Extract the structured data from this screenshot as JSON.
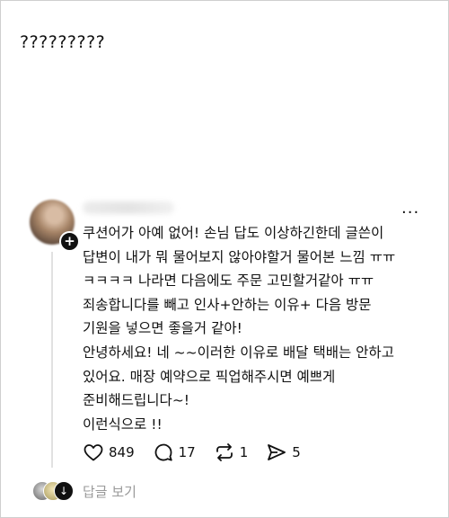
{
  "caption": "?????????",
  "post": {
    "lines": [
      "쿠션어가 아예 없어! 손님 답도 이상하긴한데 글쓴이",
      "답변이 내가 뭐 물어보지 않아야할거 물어본 느낌 ㅠㅠ",
      "ㅋㅋㅋㅋ 나라면 다음에도 주문 고민할거같아 ㅠㅠ",
      "죄송합니다를 빼고 인사+안하는 이유+ 다음 방문",
      "기원을 넣으면 좋을거 같아!",
      "안녕하세요! 네 ~~이러한 이유로 배달 택배는 안하고",
      "있어요. 매장 예약으로 픽업해주시면 예쁘게",
      "준비해드립니다~!",
      "이런식으로 !!"
    ]
  },
  "actions": {
    "likes": "849",
    "comments": "17",
    "reposts": "1",
    "shares": "5"
  },
  "replies": {
    "label": "답글 보기"
  },
  "icons": [
    "heart-icon",
    "comment-icon",
    "repost-icon",
    "share-icon",
    "more-icon",
    "follow-plus-icon"
  ]
}
